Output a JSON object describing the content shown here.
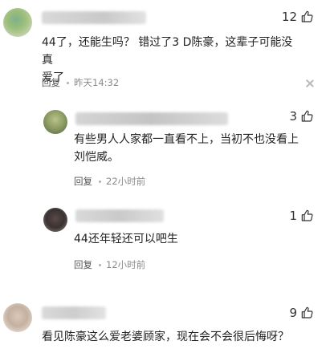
{
  "comments": [
    {
      "likes": "12",
      "text_lines": [
        "44了，还能生吗？ 错过了3 D陈豪，这辈子可能没真",
        "爱了"
      ],
      "reply_label": "回复",
      "time": "昨天14:32"
    },
    {
      "likes": "3",
      "text_lines": [
        "有些男人人家都一直看不上，当初不也没看上",
        "刘恺威。"
      ],
      "reply_label": "回复",
      "time": "22小时前"
    },
    {
      "likes": "1",
      "text_lines": [
        "44还年轻还可以吧生"
      ],
      "reply_label": "回复",
      "time": "12小时前"
    },
    {
      "likes": "9",
      "text_lines": [
        "看见陈豪这么爱老婆顾家，现在会不会很后悔呀？"
      ]
    }
  ],
  "icons": {
    "like": "thumbs-up-icon",
    "close": "close-icon"
  },
  "colors": {
    "text": "#222222",
    "meta": "#8a8a8a",
    "close": "#b8b8b8"
  }
}
